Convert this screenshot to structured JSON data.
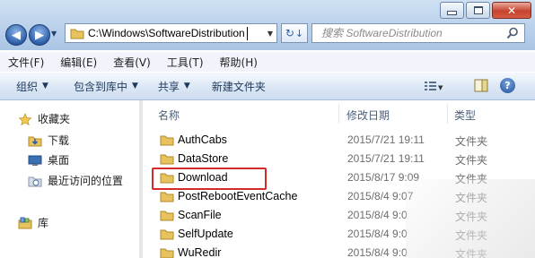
{
  "window": {
    "controls": [
      "minimize",
      "maximize",
      "close"
    ]
  },
  "address_bar": {
    "path": "C:\\Windows\\SoftwareDistribution",
    "search_placeholder": "搜索 SoftwareDistribution"
  },
  "menu": [
    "文件(F)",
    "编辑(E)",
    "查看(V)",
    "工具(T)",
    "帮助(H)"
  ],
  "toolbar": {
    "organize": "组织",
    "include_in_library": "包含到库中",
    "share": "共享",
    "new_folder": "新建文件夹"
  },
  "nav_pane": {
    "favorites": "收藏夹",
    "downloads": "下载",
    "desktop": "桌面",
    "recent_places": "最近访问的位置",
    "libraries": "库"
  },
  "columns": {
    "name": "名称",
    "date": "修改日期",
    "type": "类型"
  },
  "files": [
    {
      "name": "AuthCabs",
      "date": "2015/7/21 19:11",
      "type": "文件夹"
    },
    {
      "name": "DataStore",
      "date": "2015/7/21 19:11",
      "type": "文件夹"
    },
    {
      "name": "Download",
      "date": "2015/8/17 9:09",
      "type": "文件夹"
    },
    {
      "name": "PostRebootEventCache",
      "date": "2015/8/4 9:07",
      "type": "文件夹"
    },
    {
      "name": "ScanFile",
      "date": "2015/8/4 9:0",
      "type": "文件夹"
    },
    {
      "name": "SelfUpdate",
      "date": "2015/8/4 9:0",
      "type": "文件夹"
    },
    {
      "name": "WuRedir",
      "date": "2015/8/4 9:0",
      "type": "文件夹"
    }
  ],
  "highlighted_file": "Download",
  "colors": {
    "highlight_border": "#d42a2a",
    "folder": "#e8c25c",
    "chrome": "#b9d0ea"
  }
}
